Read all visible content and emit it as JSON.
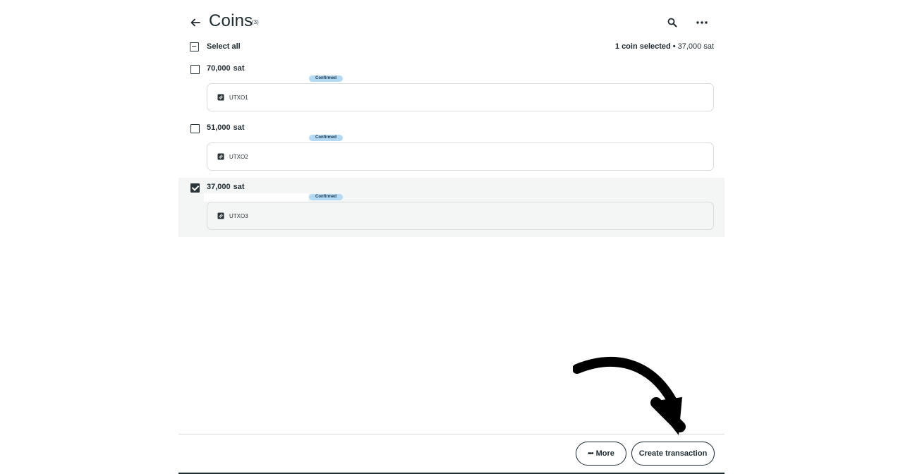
{
  "header": {
    "title": "Coins",
    "count": "(3)",
    "back_icon": "arrow-left-icon",
    "search_icon": "search-icon",
    "more_icon": "more-horizontal-icon"
  },
  "selection": {
    "select_all_label": "Select all",
    "summary_selected": "1 coin selected",
    "summary_separator": "•",
    "summary_amount": "37,000 sat"
  },
  "coins": [
    {
      "amount": "70,000",
      "unit": "sat",
      "status": "Confirmed",
      "label": "UTXO1",
      "selected": false
    },
    {
      "amount": "51,000",
      "unit": "sat",
      "status": "Confirmed",
      "label": "UTXO2",
      "selected": false
    },
    {
      "amount": "37,000",
      "unit": "sat",
      "status": "Confirmed",
      "label": "UTXO3",
      "selected": true
    }
  ],
  "footer": {
    "more_label": "More",
    "create_label": "Create transaction"
  },
  "colors": {
    "text": "#1f2a30",
    "badge_bg": "#b3d9f3",
    "selected_row_bg": "#f4f5f5"
  }
}
